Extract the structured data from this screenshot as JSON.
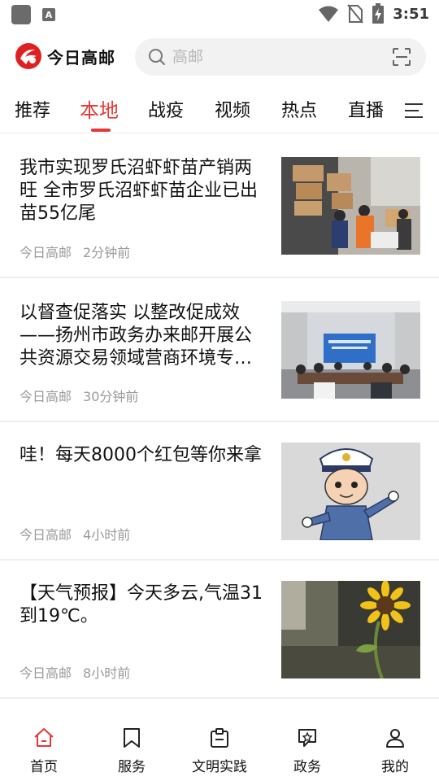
{
  "status_bar": {
    "time": "3:51",
    "notification_badge": "A"
  },
  "header": {
    "app_name": "今日高邮",
    "search_placeholder": "高邮",
    "accent_color": "#e53935"
  },
  "tabs": [
    {
      "label": "推荐",
      "active": false
    },
    {
      "label": "本地",
      "active": true
    },
    {
      "label": "战疫",
      "active": false
    },
    {
      "label": "视频",
      "active": false
    },
    {
      "label": "热点",
      "active": false
    },
    {
      "label": "直播",
      "active": false
    }
  ],
  "news": [
    {
      "title": "我市实现罗氏沼虾虾苗产销两旺 全市罗氏沼虾虾苗企业已出苗55亿尾",
      "source": "今日高邮",
      "time": "2分钟前",
      "thumbnail": "workers-unloading-boxes-photo"
    },
    {
      "title": " 以督查促落实 以整改促成效——扬州市政务办来邮开展公共资源交易领域营商环境专项督查",
      "source": "今日高邮",
      "time": "30分钟前",
      "thumbnail": "meeting-room-photo"
    },
    {
      "title": "哇！每天8000个红包等你来拿",
      "source": "今日高邮",
      "time": "4小时前",
      "thumbnail": "cartoon-police-officer-illustration"
    },
    {
      "title": "【天气预报】今天多云,气温31到19℃。",
      "source": "今日高邮",
      "time": "8小时前",
      "thumbnail": "sunflower-photo"
    }
  ],
  "bottom_nav": [
    {
      "label": "首页",
      "icon": "home-icon",
      "active": true
    },
    {
      "label": "服务",
      "icon": "bookmark-icon",
      "active": false
    },
    {
      "label": "文明实践",
      "icon": "clipboard-icon",
      "active": false
    },
    {
      "label": "政务",
      "icon": "chat-star-icon",
      "active": false
    },
    {
      "label": "我的",
      "icon": "user-icon",
      "active": false
    }
  ]
}
